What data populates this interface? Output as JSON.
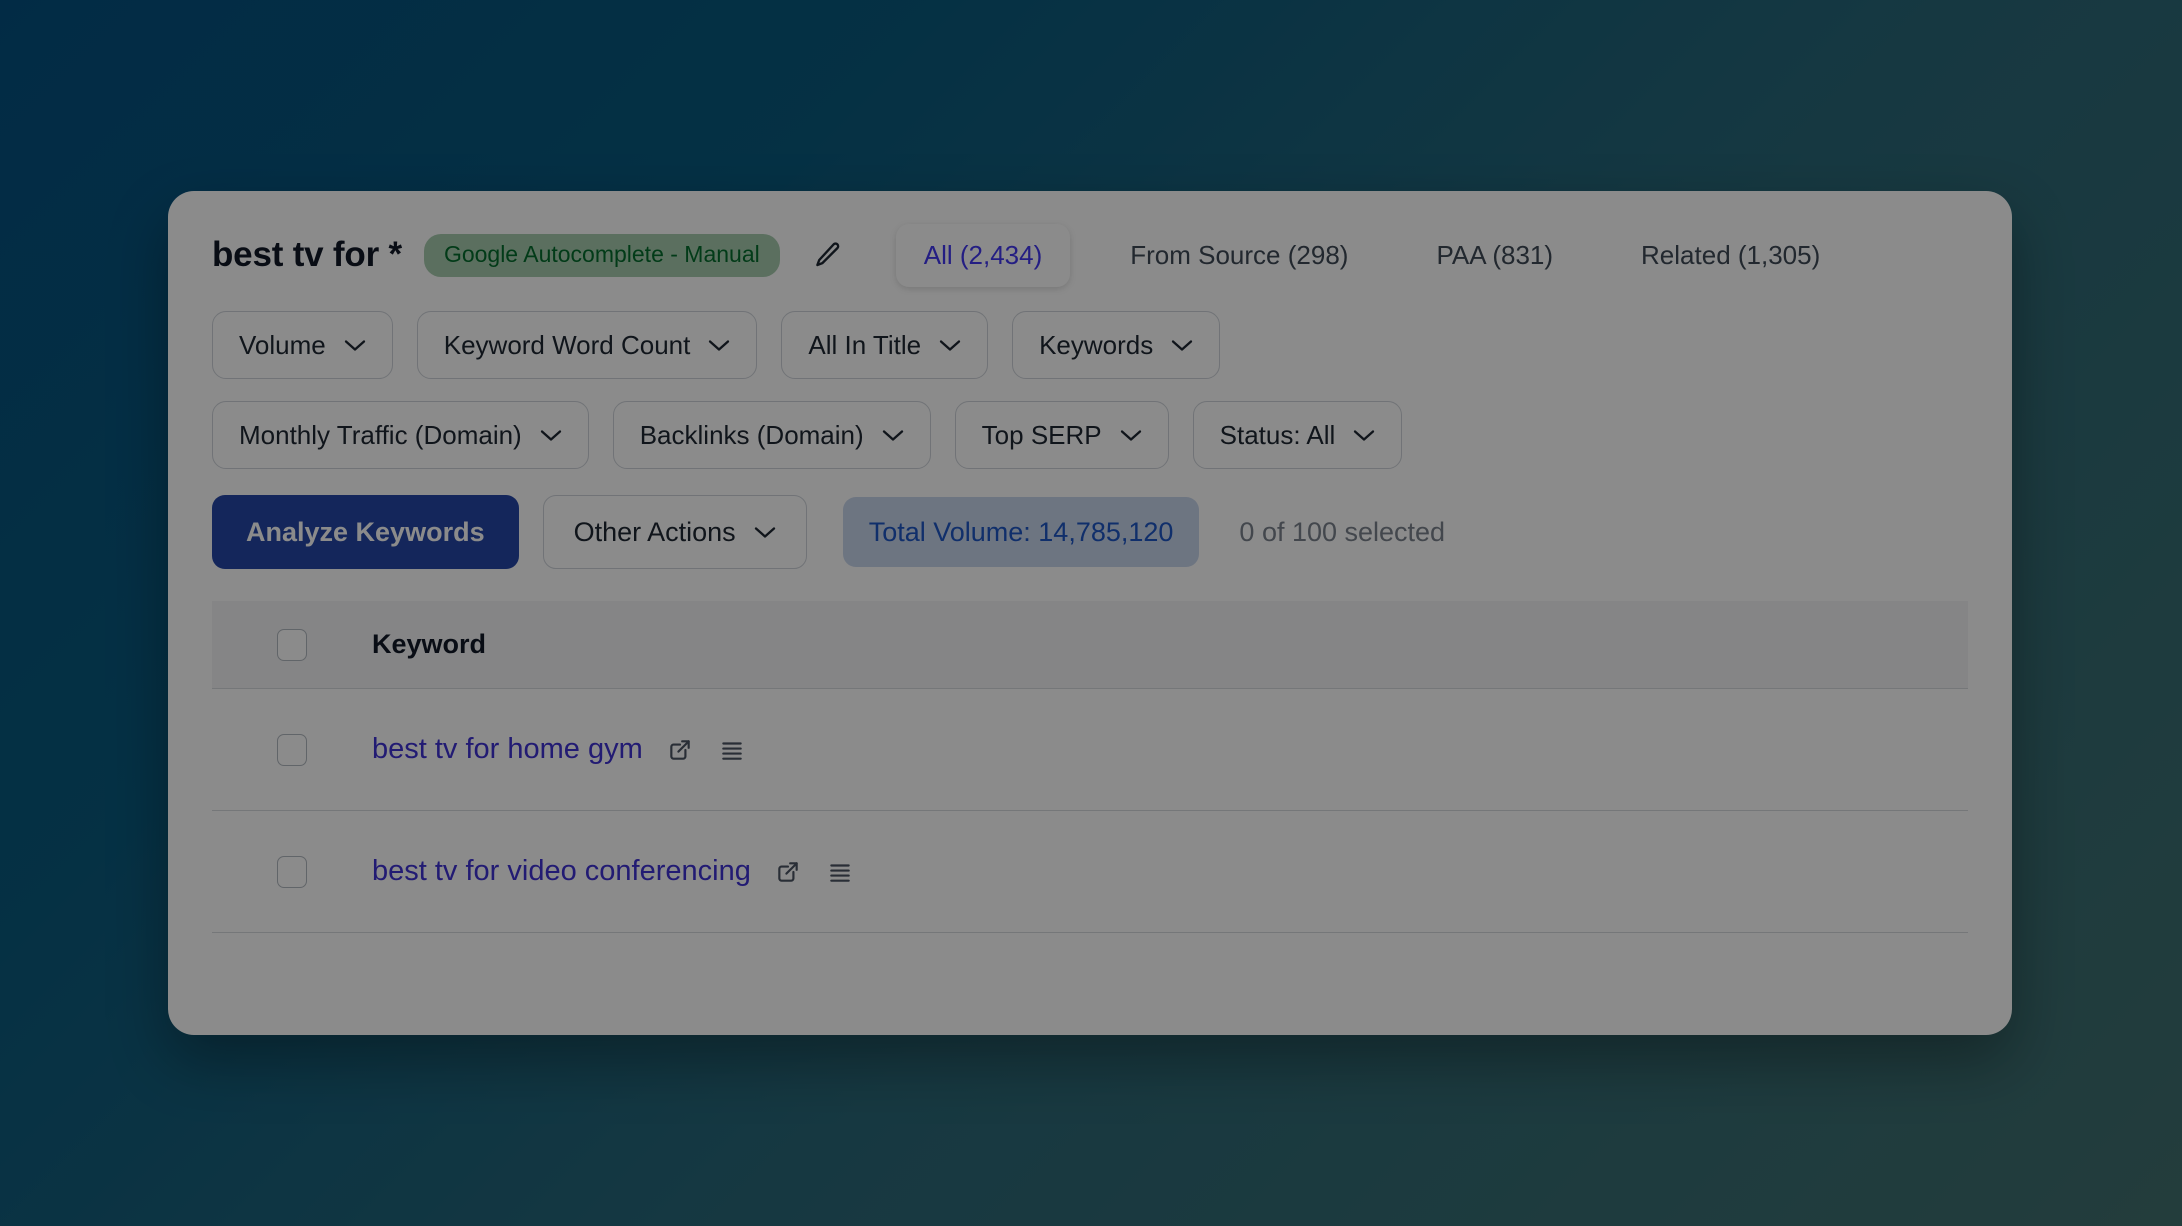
{
  "header": {
    "title": "best tv for *",
    "source_badge": "Google Autocomplete - Manual",
    "edit_icon": "pencil-icon"
  },
  "tabs": [
    {
      "label": "All (2,434)",
      "active": true
    },
    {
      "label": "From Source (298)",
      "active": false
    },
    {
      "label": "PAA (831)",
      "active": false
    },
    {
      "label": "Related (1,305)",
      "active": false
    }
  ],
  "filters_row_one": [
    {
      "label": "Volume"
    },
    {
      "label": "Keyword Word Count"
    },
    {
      "label": "All In Title"
    },
    {
      "label": "Keywords"
    }
  ],
  "filters_row_two": [
    {
      "label": "Monthly Traffic (Domain)"
    },
    {
      "label": "Backlinks (Domain)"
    },
    {
      "label": "Top SERP"
    },
    {
      "label": "Status: All"
    }
  ],
  "actions": {
    "analyze_label": "Analyze Keywords",
    "other_actions_label": "Other Actions",
    "total_volume_label": "Total Volume: 14,785,120",
    "selected_label": "0 of 100 selected"
  },
  "table": {
    "column_header": "Keyword",
    "rows": [
      {
        "keyword": "best tv for home gym"
      },
      {
        "keyword": "best tv for video conferencing"
      }
    ]
  },
  "colors": {
    "accent_blue": "#2547a8",
    "link_indigo": "#3f32d4",
    "tab_active_text": "#4338f0",
    "badge_green_bg": "#a7ccae",
    "badge_green_text": "#046c2d",
    "volume_badge_bg": "#c9d6ec",
    "volume_badge_text": "#1f56c4",
    "background_from": "#05507f",
    "background_to": "#41706f"
  }
}
